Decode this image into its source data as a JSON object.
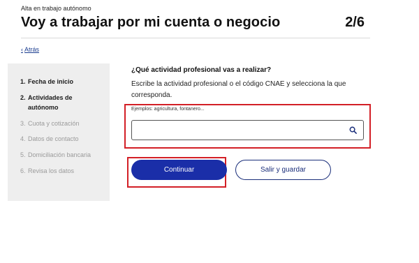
{
  "header": {
    "overline": "Alta en trabajo autónomo",
    "title": "Voy a trabajar por mi cuenta o negocio",
    "step_counter": "2/6"
  },
  "back_link": {
    "chevron": "‹",
    "label": "Atrás"
  },
  "sidebar": {
    "steps": [
      {
        "num": "1.",
        "label": "Fecha de inicio",
        "state": "active"
      },
      {
        "num": "2.",
        "label": "Actividades de",
        "label_line2": "autónomo",
        "state": "active"
      },
      {
        "num": "3.",
        "label": "Cuota y cotización",
        "state": "inactive"
      },
      {
        "num": "4.",
        "label": "Datos de contacto",
        "state": "inactive"
      },
      {
        "num": "5.",
        "label": "Domiciliación bancaria",
        "state": "inactive"
      },
      {
        "num": "6.",
        "label": "Revisa los datos",
        "state": "inactive"
      }
    ]
  },
  "main": {
    "question": "¿Qué actividad profesional vas a realizar?",
    "description": "Escribe la actividad profesional o el código CNAE y selecciona la que corresponda.",
    "search": {
      "hint": "Ejemplos: agricultura, fontanero...",
      "value": "",
      "placeholder": ""
    },
    "continue_label": "Continuar",
    "save_label": "Salir y guardar"
  },
  "colors": {
    "primary": "#1a2ea8",
    "highlight": "#d31f26",
    "sidebar_bg": "#eeeeee",
    "link": "#1a3c8f"
  },
  "icons": {
    "search": "magnifier-icon",
    "back": "chevron-left-icon"
  }
}
